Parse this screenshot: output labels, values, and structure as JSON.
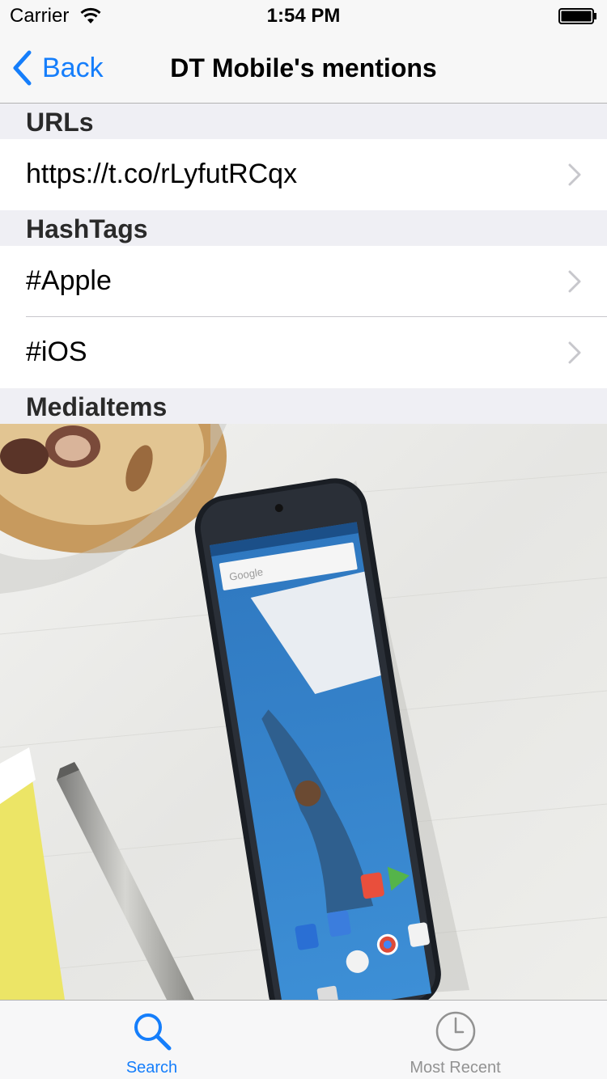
{
  "status_bar": {
    "carrier": "Carrier",
    "time": "1:54 PM"
  },
  "nav_bar": {
    "back_label": "Back",
    "title": "DT Mobile's mentions"
  },
  "sections": {
    "urls": {
      "header": "URLs",
      "items": [
        "https://t.co/rLyfutRCqx"
      ]
    },
    "hashtags": {
      "header": "HashTags",
      "items": [
        "#Apple",
        "#iOS"
      ]
    },
    "media": {
      "header": "MediaItems"
    }
  },
  "tab_bar": {
    "tabs": [
      {
        "label": "Search",
        "icon": "search-icon",
        "selected": true
      },
      {
        "label": "Most Recent",
        "icon": "clock-icon",
        "selected": false
      }
    ]
  },
  "colors": {
    "accent": "#157efb",
    "inactive": "#929292",
    "grouped_background": "#efeff4"
  }
}
